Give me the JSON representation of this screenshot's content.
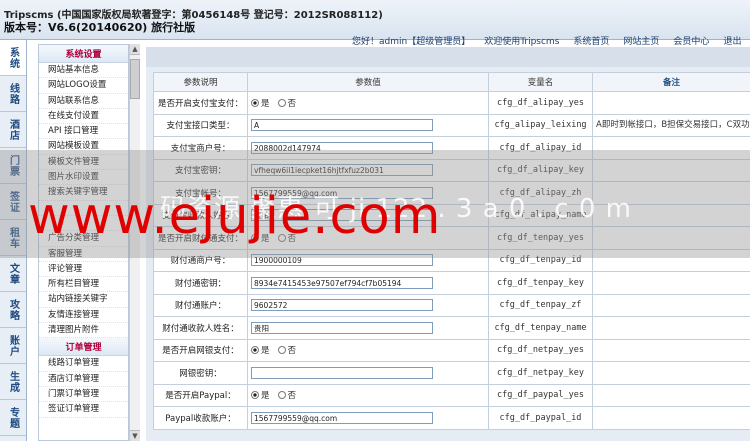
{
  "header": {
    "line1": "Tripscms (中国国家版权局软著登字：第0456148号 登记号：2012SR088112)",
    "line2": "版本号：V6.6(20140620) 旅行社版",
    "topnav": [
      "您好！admin【超级管理员】",
      "欢迎使用Tripscms",
      "系统首页",
      "网站主页",
      "会员中心",
      "退出"
    ]
  },
  "vtabs": [
    "系统",
    "线路",
    "酒店",
    "门票",
    "签证",
    "租车",
    "文章",
    "攻略",
    "账户",
    "生成",
    "专题"
  ],
  "menu": {
    "section1": "系统设置",
    "items1": [
      "网站基本信息",
      "网站LOGO设置",
      "网站联系信息",
      "在线支付设置",
      "API 接口管理",
      "网站模板设置",
      "模板文件管理",
      "图片水印设置",
      "搜索关键字管理",
      "",
      "",
      "广告分类管理",
      "客服管理",
      "评论管理",
      "所有栏目管理",
      "站内链接关键字",
      "友情连接管理",
      "清理图片附件"
    ],
    "section2": "订单管理",
    "items2": [
      "线路订单管理",
      "酒店订单管理",
      "门票订单管理",
      "签证订单管理"
    ]
  },
  "table": {
    "headers": [
      "参数说明",
      "参数值",
      "变量名",
      "备注"
    ],
    "rows": [
      {
        "label": "是否开启支付宝支付：",
        "type": "radio",
        "yes": "是",
        "no": "否",
        "selected": "yes",
        "var": "cfg_df_alipay_yes",
        "note": ""
      },
      {
        "label": "支付宝接口类型：",
        "type": "input",
        "value": "A",
        "var": "cfg_alipay_leixing",
        "note": "A即时到帐接口，B担保交易接口，C双功能收款"
      },
      {
        "label": "支付宝商户号：",
        "type": "input",
        "value": "2088002d147974",
        "var": "cfg_df_alipay_id",
        "note": ""
      },
      {
        "label": "支付宝密钥：",
        "type": "input",
        "value": "vfheqw6il1iecpket16hjtfxfuz2b031",
        "var": "cfg_df_alipay_key",
        "note": ""
      },
      {
        "label": "支付宝帐号：",
        "type": "input",
        "value": "1567799559@qq.com",
        "var": "cfg_df_alipay_zh",
        "note": ""
      },
      {
        "label": "支付宝收款人姓名：",
        "type": "input",
        "value": "贵阳",
        "var": "cfg_df_alipay_name",
        "note": ""
      },
      {
        "label": "是否开启财付通支付：",
        "type": "radio",
        "yes": "是",
        "no": "否",
        "selected": "yes",
        "var": "cfg_df_tenpay_yes",
        "note": ""
      },
      {
        "label": "财付通商户号：",
        "type": "input",
        "value": "1900000109",
        "var": "cfg_df_tenpay_id",
        "note": ""
      },
      {
        "label": "财付通密钥：",
        "type": "input",
        "value": "8934e7415453e97507ef794cf7b05194",
        "var": "cfg_df_tenpay_key",
        "note": ""
      },
      {
        "label": "财付通账户：",
        "type": "input",
        "value": "9602572",
        "var": "cfg_df_tenpay_zf",
        "note": ""
      },
      {
        "label": "财付通收款人姓名：",
        "type": "input",
        "value": "贵阳",
        "var": "cfg_df_tenpay_name",
        "note": ""
      },
      {
        "label": "是否开启网银支付：",
        "type": "radio",
        "yes": "是",
        "no": "否",
        "selected": "yes",
        "var": "cfg_df_netpay_yes",
        "note": ""
      },
      {
        "label": "网银密钥：",
        "type": "input",
        "value": "",
        "var": "cfg_df_netpay_key",
        "note": ""
      },
      {
        "label": "是否开启Paypal：",
        "type": "radio",
        "yes": "是",
        "no": "否",
        "selected": "yes",
        "var": "cfg_df_paypal_yes",
        "note": ""
      },
      {
        "label": "Paypal收款账户：",
        "type": "input",
        "value": "1567799559@qq.com",
        "var": "cfg_df_paypal_id",
        "note": ""
      }
    ]
  },
  "watermark": {
    "main": "www.ejujie.com",
    "sub": "码资源 聚惠 可 ji 122 . 3 a 0 . c 0 m"
  }
}
